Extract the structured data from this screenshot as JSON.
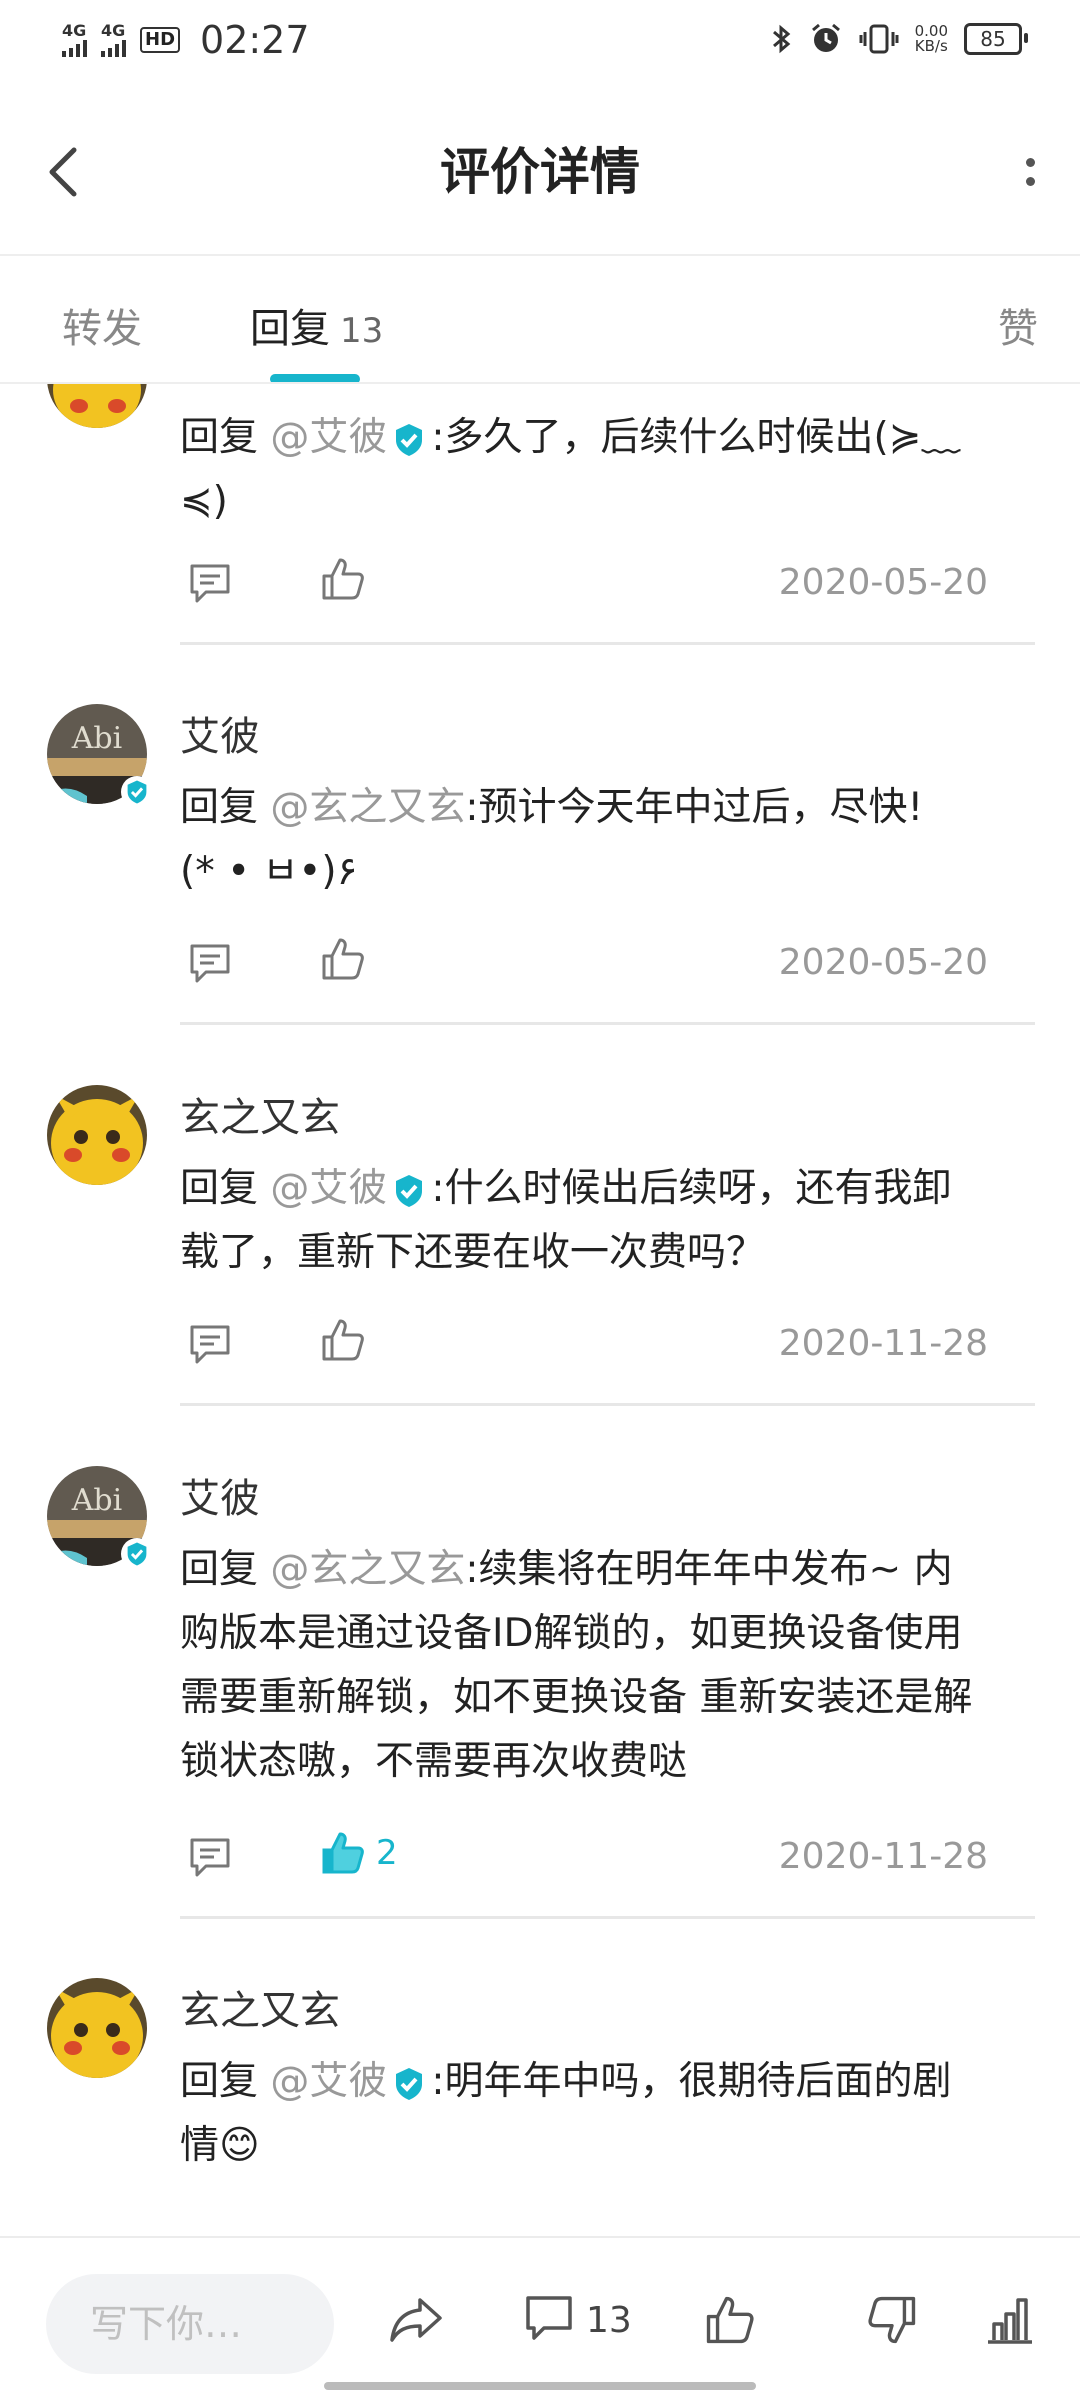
{
  "status_bar": {
    "network_1": "4G",
    "network_2": "4G",
    "hd_label": "HD",
    "time": "02:27",
    "net_speed_value": "0.00",
    "net_speed_unit": "KB/s",
    "battery": "85"
  },
  "header": {
    "title": "评价详情"
  },
  "tabs": [
    {
      "label": "转发"
    },
    {
      "label": "回复",
      "count": "13"
    },
    {
      "label": "赞"
    }
  ],
  "comments": [
    {
      "user": "",
      "prefix": "回复 ",
      "mention": "@艾彼",
      "mention_verified": true,
      "text_1": ":多久了，后续什么时候出(≽﹏",
      "text_2": "≼)",
      "date": "2020-05-20",
      "likes": ""
    },
    {
      "user": "艾彼",
      "prefix": "回复 ",
      "mention": "@玄之又玄",
      "text_1": ":预计今天年中过后，尽快!",
      "text_2": "(* • ㅂ•)۶",
      "date": "2020-05-20",
      "likes": ""
    },
    {
      "user": "玄之又玄",
      "prefix": "回复 ",
      "mention": "@艾彼",
      "mention_verified": true,
      "text_1": ":什么时候出后续呀，还有我卸",
      "text_2": "载了，重新下还要在收一次费吗？",
      "date": "2020-11-28",
      "likes": ""
    },
    {
      "user": "艾彼",
      "prefix": "回复 ",
      "mention": "@玄之又玄",
      "text_1": ":续集将在明年年中发布~ 内",
      "text_2": "购版本是通过设备ID解锁的，如更换设备使用",
      "text_3": "需要重新解锁，如不更换设备 重新安装还是解",
      "text_4": "锁状态嗷，不需要再次收费哒",
      "date": "2020-11-28",
      "likes": "2"
    },
    {
      "user": "玄之又玄",
      "prefix": "回复 ",
      "mention": "@艾彼",
      "mention_verified": true,
      "text_1": ":明年年中吗，很期待后面的剧",
      "text_2": "情😊",
      "date": "",
      "likes": ""
    }
  ],
  "avatars": {
    "abi_text": "Abi"
  },
  "bottom_bar": {
    "placeholder": "写下你…",
    "comment_count": "13"
  },
  "colors": {
    "accent": "#17b5cc",
    "pikachu_yellow": "#f2c321"
  }
}
